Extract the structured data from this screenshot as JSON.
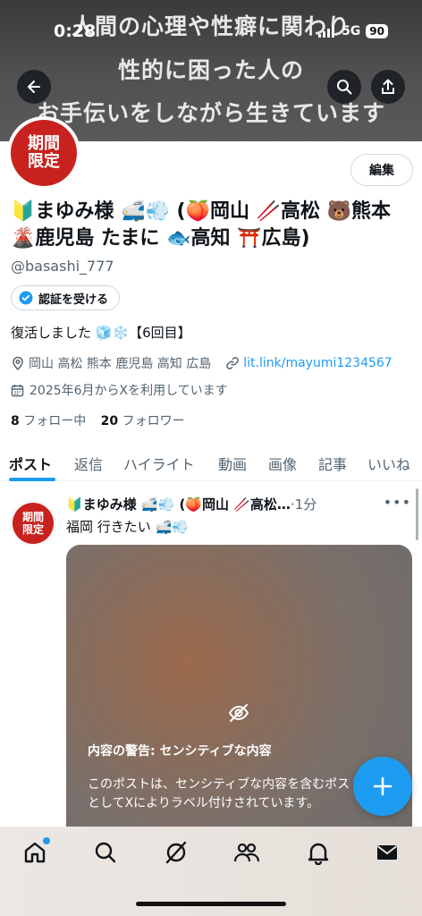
{
  "status_bar": {
    "time": "0:28",
    "network": "5G",
    "battery": "90"
  },
  "banner": {
    "lines": [
      "人間の心理や性癖に関わり",
      "性的に困った人の",
      "お手伝いをしながら生きています"
    ]
  },
  "avatar_text": [
    "期間",
    "限定"
  ],
  "edit_label": "編集",
  "profile": {
    "name": "🔰まゆみ様 🚅💨 (🍑岡山 🥢高松 🐻熊本 🌋鹿児島 たまに 🐟高知 ⛩️広島)",
    "handle": "@basashi_777",
    "verify_label": "認証を受ける",
    "bio": "復活しました 🧊❄️【6回目】",
    "location": "岡山 高松 熊本 鹿児島 高知 広島",
    "link": "lit.link/mayumi1234567",
    "joined": "2025年6月からXを利用しています",
    "following_count": "8",
    "following_label": "フォロー中",
    "followers_count": "20",
    "followers_label": "フォロワー"
  },
  "tabs": [
    "ポスト",
    "返信",
    "ハイライト",
    "動画",
    "画像",
    "記事",
    "いいね"
  ],
  "post": {
    "name": "🔰まゆみ様 🚅💨 (🍑岡山 🥢高松…",
    "time": "·1分",
    "text": "福岡 行きたい 🚅💨",
    "warning_title": "内容の警告: センシティブな内容",
    "warning_body": "このポストは、センシティブな内容を含むポストとしてXによりラベル付けされています。"
  },
  "bottom_nav": [
    "home-icon",
    "search-icon",
    "grok-icon",
    "communities-icon",
    "notifications-icon",
    "messages-icon"
  ],
  "colors": {
    "accent": "#1d9bf0",
    "avatar_red": "#c8221f"
  }
}
